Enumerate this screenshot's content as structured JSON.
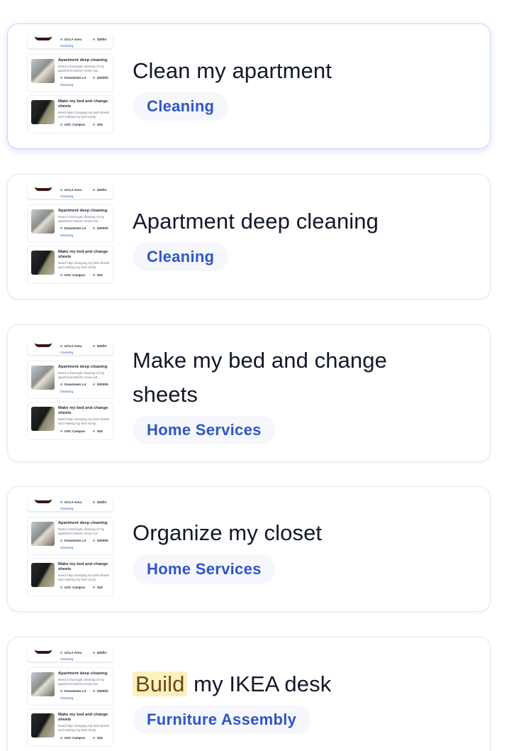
{
  "thumbnail": {
    "top_card": {
      "location": "UCLA Area",
      "price": "$25/hr",
      "tag": "Cleaning"
    },
    "card2": {
      "title": "Apartment deep cleaning",
      "description": "Need a thorough cleaning of my apartment before move-out...",
      "location": "Downtown LA",
      "price": "$300/hr",
      "tag": "Cleaning"
    },
    "card3": {
      "title": "Make my bed and change sheets",
      "description": "Need help changing my bed sheets and making my bed nicely.",
      "location": "USC Campus",
      "price": "$15"
    }
  },
  "results": [
    {
      "title": "Clean my apartment",
      "category": "Cleaning",
      "active": true
    },
    {
      "title": "Apartment deep cleaning",
      "category": "Cleaning"
    },
    {
      "title": "Make my bed and change sheets",
      "category": "Home Services"
    },
    {
      "title": "Organize my closet",
      "category": "Home Services"
    },
    {
      "title_highlight": "Build",
      "title_rest": " my IKEA desk",
      "category": "Furniture Assembly"
    }
  ],
  "colors": {
    "accent": "#2f56c8",
    "highlight_bg": "#fdf0bf",
    "highlight_text": "#6b4a12"
  }
}
